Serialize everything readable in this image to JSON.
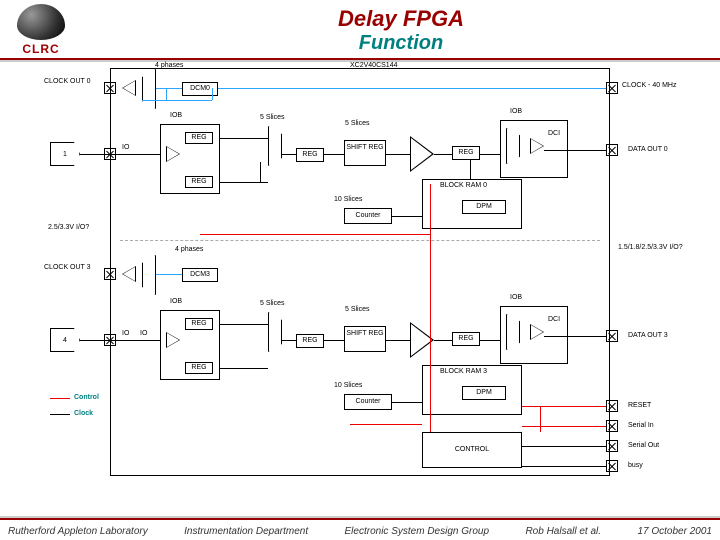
{
  "header": {
    "logo_text": "CLRC",
    "title": "Delay FPGA",
    "subtitle": "Function"
  },
  "diagram": {
    "chip": "XC2V40CS144",
    "clock_freq": "CLOCK - 40 MHz",
    "four_phases": "4 phases",
    "io_voltage": "2.5/3.3V I/O?",
    "io_voltage_full": "1.5/1.8/2.5/3.3V I/O?",
    "io": "IO",
    "iob": "IOB",
    "dcm0": "DCM0",
    "dcm3": "DCM3",
    "reg": "REG",
    "shift_reg": "SHIFT REG",
    "dci": "DCI",
    "counter": "Counter",
    "dpm": "DPM",
    "block_ram0": "BLOCK RAM 0",
    "block_ram3": "BLOCK RAM 3",
    "slices5": "5 Slices",
    "slices10": "10 Slices",
    "clock_out0": "CLOCK OUT 0",
    "clock_out3": "CLOCK OUT 3",
    "data_out0": "DATA OUT 0",
    "data_out3": "DATA OUT 3",
    "src1": "1",
    "src4": "4",
    "reset": "RESET",
    "serial_in": "Serial In",
    "serial_out": "Serial Out",
    "busy": "busy",
    "control_box": "CONTROL",
    "legend_control": "Control",
    "legend_clock": "Clock"
  },
  "footer": {
    "lab": "Rutherford Appleton Laboratory",
    "dept": "Instrumentation Department",
    "group": "Electronic System Design Group",
    "author": "Rob Halsall et al.",
    "date": "17 October 2001"
  }
}
